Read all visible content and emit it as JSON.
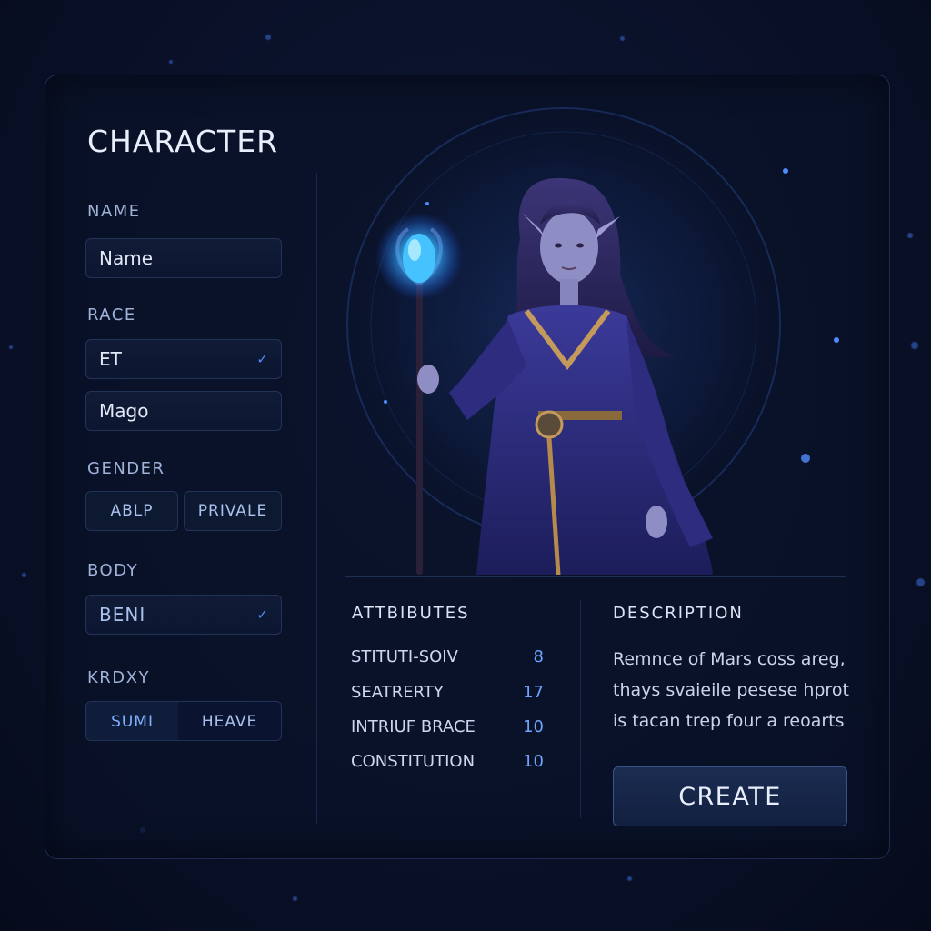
{
  "title": "CHARACTER",
  "name_section": {
    "label": "NAME",
    "value": "Name"
  },
  "race_section": {
    "label": "RACE",
    "selected": "ET",
    "class_value": "Mago"
  },
  "gender_section": {
    "label": "GENDER",
    "options": [
      "ABLP",
      "PRIVALE"
    ]
  },
  "body_section": {
    "label": "BODY",
    "selected": "BENI"
  },
  "kirdxy_section": {
    "label": "KRDXY",
    "options": [
      "SUMI",
      "HEAVE"
    ]
  },
  "attributes": {
    "title": "ATTBIBUTES",
    "rows": [
      {
        "name": "STITUTI-SOIV",
        "value": "8"
      },
      {
        "name": "SEATRERTY",
        "value": "17"
      },
      {
        "name": "INTRIUF BRACE",
        "value": "10"
      },
      {
        "name": "CONSTITUTION",
        "value": "10"
      }
    ]
  },
  "description": {
    "title": "DESCRIPTION",
    "text": "Remnce of Mars coss areg, thays svaieile pesese hprot is tacan trep four a reoarts"
  },
  "create_button": "CREATE",
  "colors": {
    "accent": "#4f8cff",
    "panel_border": "#1e2c52",
    "orb": "#39b8ff",
    "robe": "#2c2a7a"
  },
  "icons": [
    "check-icon",
    "staff-orb-icon"
  ]
}
